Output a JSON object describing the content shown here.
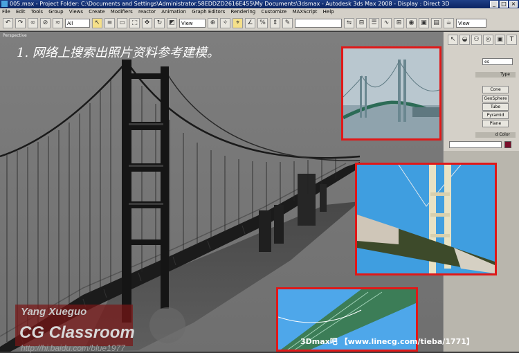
{
  "window": {
    "title": "005.max    - Project Folder: C:\\Documents and Settings\\Administrator.58EDDZD2616E455\\My Documents\\3dsmax    - Autodesk 3ds Max 2008    - Display : Direct 3D"
  },
  "menu": [
    "File",
    "Edit",
    "Tools",
    "Group",
    "Views",
    "Create",
    "Modifiers",
    "reactor",
    "Animation",
    "Graph Editors",
    "Rendering",
    "Customize",
    "MAXScript",
    "Help"
  ],
  "toolbar": {
    "selection_filter": "All",
    "ref_coord": "View",
    "view_right": "View"
  },
  "viewport": {
    "label": "Perspective",
    "caption": "1. 网络上搜索出照片资料参考建模。"
  },
  "command_panel": {
    "dropdown": "es",
    "rollout_type": "Type",
    "rollout_color": "d Color",
    "buttons": [
      "Cone",
      "GeoSphere",
      "Tube",
      "Pyramid",
      "Plane"
    ],
    "swatch_color": "#7a0f2a"
  },
  "watermark": {
    "line1": "Yang Xueguo",
    "line2": "CG Classroom",
    "line3": "http://hi.baidu.com/blue1977",
    "site": "3Dmax吧 【www.linecg.com/tieba/1771】"
  },
  "colors": {
    "photo_border": "#e01818",
    "menubar": "#d4d0c8",
    "titlebar": "#0b2462"
  }
}
